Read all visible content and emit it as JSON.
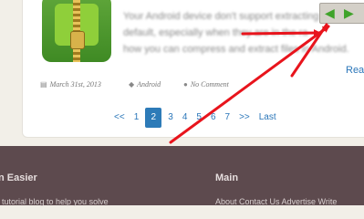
{
  "post": {
    "excerpt_lines": [
      "Your Android device don't support extracting",
      "default, especially when they are in the ra",
      "how you can compress and extract files in Android."
    ],
    "read_more": "Rea",
    "date": "March 31st, 2013",
    "category": "Android",
    "comments": "No Comment"
  },
  "pagination": {
    "first": "<<",
    "pages": [
      "1",
      "2",
      "3",
      "4",
      "5",
      "6",
      "7"
    ],
    "current": "2",
    "next": ">>",
    "last": "Last"
  },
  "footer": {
    "left_heading": "n Easier",
    "left_text": "tutorial blog to help you solve",
    "right_heading": "Main",
    "right_links": "About Contact Us Advertise Write"
  },
  "browser_nav": {
    "back_icon": "back-arrow-icon",
    "forward_icon": "forward-arrow-icon"
  },
  "colors": {
    "annotation_arrow": "#e8141c",
    "link": "#2a76b9",
    "current_page": "#2d7bb8",
    "footer_bg": "#5d4a4e",
    "nav_arrow": "#3fa32a"
  }
}
